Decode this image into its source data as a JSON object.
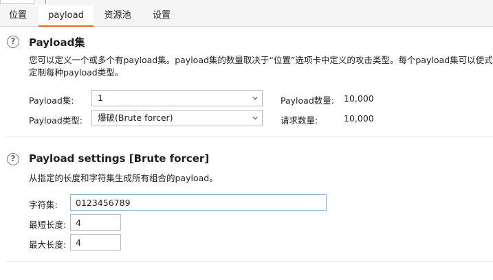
{
  "tabs": [
    {
      "label": "位置"
    },
    {
      "label": "payload"
    },
    {
      "label": "资源池"
    },
    {
      "label": "设置"
    }
  ],
  "payload_sets": {
    "title": "Payload集",
    "description": "您可以定义一个或多个有payload集。payload集的数量取决于“位置”选项卡中定义的攻击类型。每个payload集可以使式定制每种payload类型。",
    "set_label": "Payload集:",
    "set_value": "1",
    "type_label": "Payload类型:",
    "type_value": "爆破(Brute forcer)",
    "count_label": "Payload数量:",
    "count_value": "10,000",
    "request_label": "请求数量:",
    "request_value": "10,000"
  },
  "payload_settings": {
    "title": "Payload settings [Brute forcer]",
    "description": "从指定的长度和字符集生成所有组合的payload。",
    "charset_label": "字符集:",
    "charset_value": "0123456789",
    "min_label": "最短长度:",
    "min_value": "4",
    "max_label": "最大长度:",
    "max_value": "4"
  },
  "colors": {
    "accent": "#e8632b",
    "focus_border": "#8fb4d8"
  }
}
